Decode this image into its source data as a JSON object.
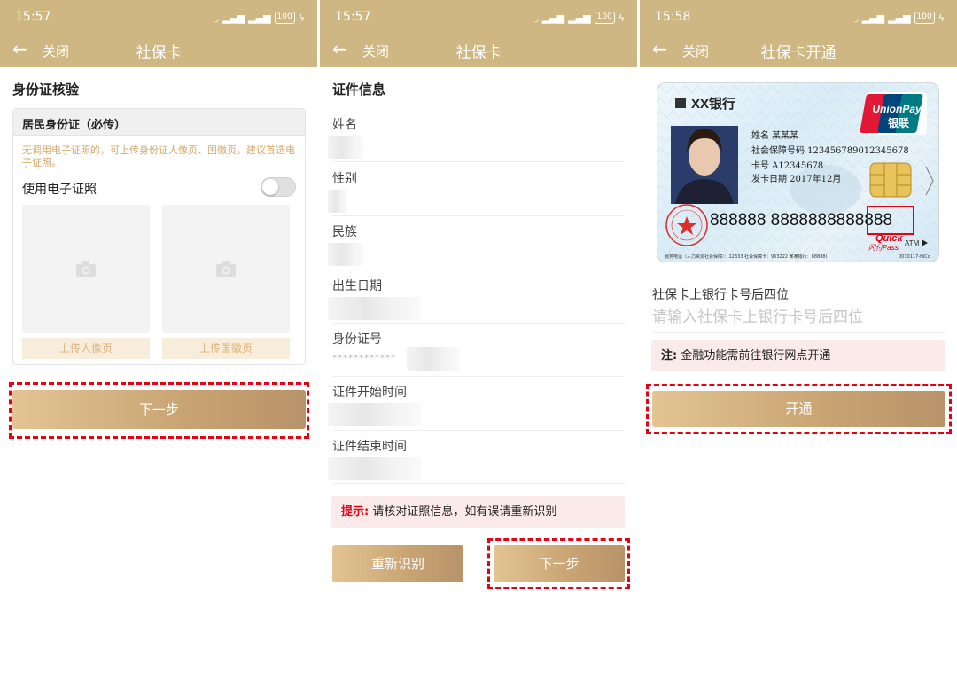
{
  "status": {
    "battery": "100"
  },
  "screen1": {
    "time": "15:57",
    "close": "关闭",
    "title": "社保卡",
    "section_title": "身份证核验",
    "card_title": "居民身份证（必传）",
    "hint": "无调用电子证照的，可上传身份证人像页、国徽页，建议首选电子证照。",
    "toggle_label": "使用电子证照",
    "toggle_on": false,
    "upload_front": "上传人像页",
    "upload_back": "上传国徽页",
    "next": "下一步"
  },
  "screen2": {
    "time": "15:57",
    "close": "关闭",
    "title": "社保卡",
    "section_title": "证件信息",
    "fields": {
      "name": "姓名",
      "gender": "性别",
      "ethnicity": "民族",
      "birth": "出生日期",
      "id_number": "身份证号",
      "id_masked": "************",
      "start": "证件开始时间",
      "end": "证件结束时间"
    },
    "tip_prefix": "提示:",
    "tip_text": "请核对证照信息，如有误请重新识别",
    "rescan": "重新识别",
    "next": "下一步"
  },
  "screen3": {
    "time": "15:58",
    "close": "关闭",
    "title": "社保卡开通",
    "card": {
      "bank": "XX银行",
      "unionpay_en": "UnionPay",
      "unionpay_cn": "银联",
      "name_line": "姓名  某某某",
      "ssn_line": "社会保障号码  123456789012345678",
      "card_line": "卡号  A12345678",
      "date_line": "发卡日期  2017年12月",
      "number": "888888 8888888888888",
      "quickpass": "Quick",
      "quickpass_cn": "闪付Pass",
      "atm": "ATM",
      "service": "服务电话（人力资源社会保障）：12333  社会保障卡：963222  某某银行：88888)",
      "code": "0010117-HiCo"
    },
    "field_label": "社保卡上银行卡号后四位",
    "placeholder": "请输入社保卡上银行卡号后四位",
    "note_prefix": "注:",
    "note_text": "金融功能需前往银行网点开通",
    "open": "开通"
  },
  "colors": {
    "header": "#cfb784",
    "accent_red": "#e60012",
    "button_start": "#e3c493",
    "button_end": "#b8936a",
    "hint": "#d6a86b"
  }
}
